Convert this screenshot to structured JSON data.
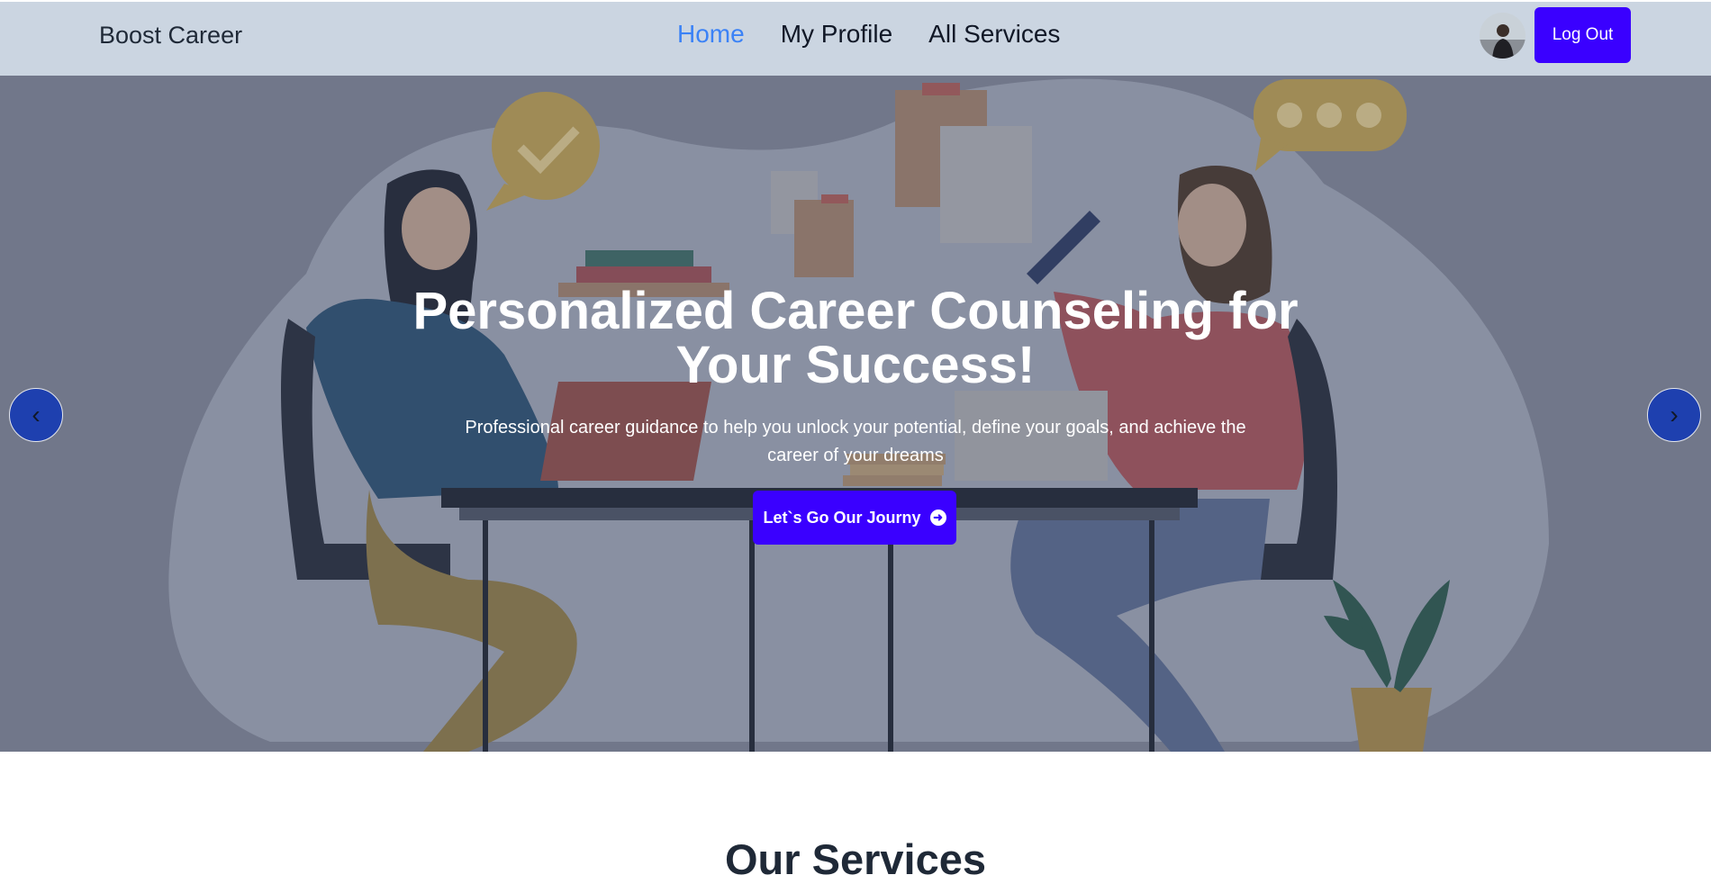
{
  "header": {
    "brand": "Boost Career",
    "nav": [
      {
        "label": "Home",
        "active": true
      },
      {
        "label": "My Profile",
        "active": false
      },
      {
        "label": "All Services",
        "active": false
      }
    ],
    "logout_label": "Log Out"
  },
  "hero": {
    "title": "Personalized Career Counseling for Your Success!",
    "subtitle": "Professional career guidance to help you unlock your potential, define your goals, and achieve the career of your dreams",
    "cta_label": "Let`s Go Our Journy",
    "prev_icon": "‹",
    "next_icon": "›"
  },
  "services": {
    "title": "Our Services"
  },
  "colors": {
    "accent": "#3a00ff",
    "nav_active": "#3b82f6",
    "header_bg": "#cbd5e1",
    "carousel_button": "#1e40af"
  },
  "icons": {
    "cta": "arrow-circle-right-icon",
    "prev": "chevron-left-icon",
    "next": "chevron-right-icon"
  }
}
